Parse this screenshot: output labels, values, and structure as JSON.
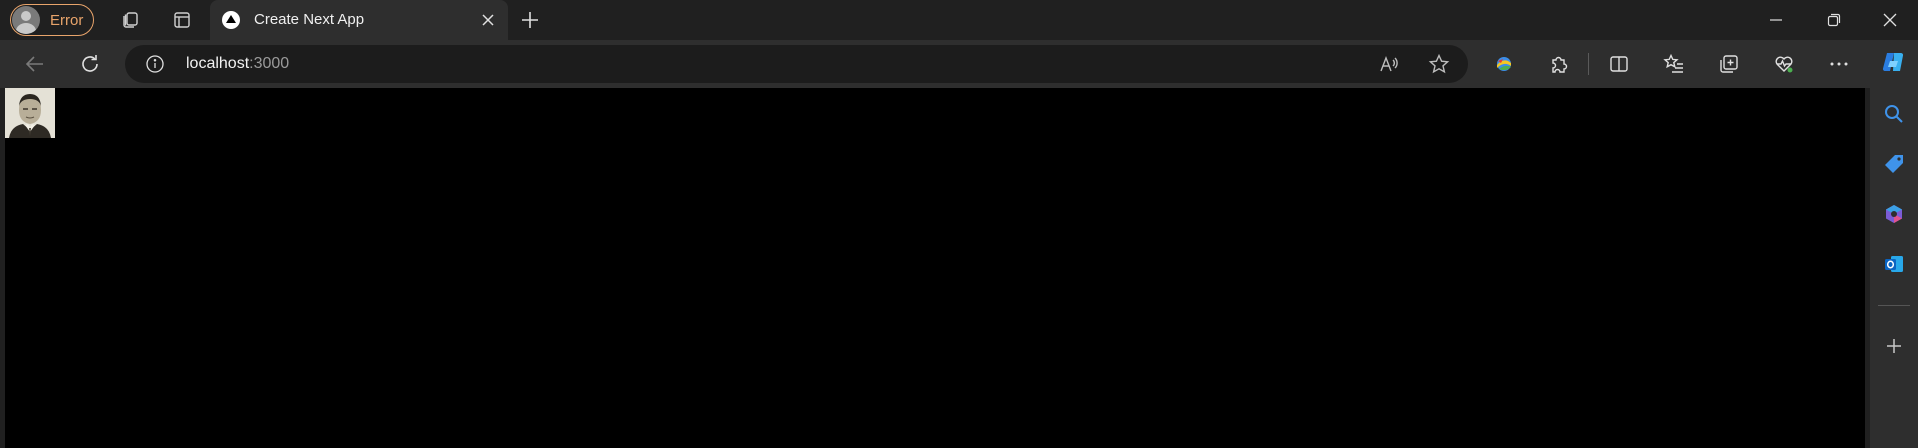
{
  "browser": {
    "profile": {
      "label": "Error",
      "accent": "#e8a46b"
    },
    "tab": {
      "title": "Create Next App",
      "favicon": "nextjs-triangle-icon"
    },
    "address": {
      "host": "localhost",
      "port": ":3000"
    }
  },
  "page": {
    "background": "#000000",
    "image": {
      "alt": "vintage portrait photo"
    }
  },
  "icons": {
    "workspaces": "workspaces-icon",
    "tab_actions": "vertical-tabs-icon",
    "close_tab": "close-icon",
    "new_tab": "plus-icon",
    "minimize": "minimize-icon",
    "restore": "restore-icon",
    "close_window": "close-icon",
    "back": "back-arrow-icon",
    "refresh": "refresh-icon",
    "site_info": "info-icon",
    "read_aloud": "read-aloud-icon",
    "favorite": "star-icon",
    "extension_1": "colorful-extension-icon",
    "extensions": "puzzle-icon",
    "split_screen": "split-screen-icon",
    "favorites": "favorites-list-icon",
    "collections": "collections-icon",
    "browser_essentials": "heart-pulse-icon",
    "more": "more-icon",
    "copilot": "copilot-icon",
    "sidebar_search": "search-icon",
    "sidebar_shopping": "tag-icon",
    "sidebar_m365": "m365-icon",
    "sidebar_outlook": "outlook-icon",
    "sidebar_add": "plus-icon"
  }
}
